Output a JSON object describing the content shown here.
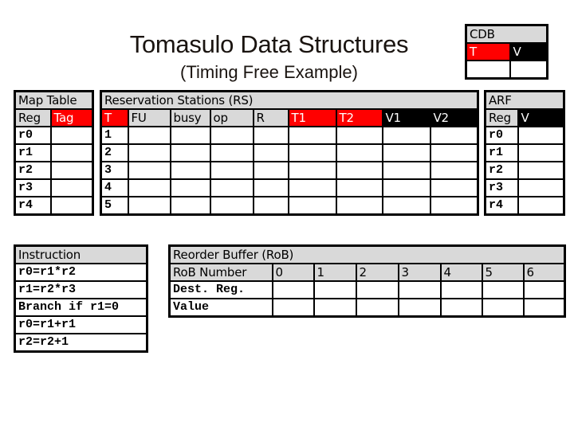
{
  "header": {
    "title": "Tomasulo Data Structures",
    "subtitle": "(Timing Free Example)"
  },
  "colors": {
    "tag_header": "#ff0000",
    "value_header": "#000000",
    "table_header": "#d9d9d9"
  },
  "cdb": {
    "title": "CDB",
    "columns": [
      "T",
      "V"
    ],
    "row": [
      "",
      ""
    ]
  },
  "map_table": {
    "title": "Map Table",
    "columns": [
      "Reg",
      "Tag"
    ],
    "rows": [
      {
        "reg": "r0",
        "tag": ""
      },
      {
        "reg": "r1",
        "tag": ""
      },
      {
        "reg": "r2",
        "tag": ""
      },
      {
        "reg": "r3",
        "tag": ""
      },
      {
        "reg": "r4",
        "tag": ""
      }
    ]
  },
  "reservation_stations": {
    "title": "Reservation Stations (RS)",
    "columns": [
      "T",
      "FU",
      "busy",
      "op",
      "R",
      "T1",
      "T2",
      "V1",
      "V2"
    ],
    "rows": [
      {
        "t": "1"
      },
      {
        "t": "2"
      },
      {
        "t": "3"
      },
      {
        "t": "4"
      },
      {
        "t": "5"
      }
    ]
  },
  "arf": {
    "title": "ARF",
    "columns": [
      "Reg",
      "V"
    ],
    "rows": [
      {
        "reg": "r0",
        "v": ""
      },
      {
        "reg": "r1",
        "v": ""
      },
      {
        "reg": "r2",
        "v": ""
      },
      {
        "reg": "r3",
        "v": ""
      },
      {
        "reg": "r4",
        "v": ""
      }
    ]
  },
  "instructions": {
    "title": "Instruction",
    "items": [
      "r0=r1*r2",
      "r1=r2*r3",
      "Branch if r1=0",
      "r0=r1+r1",
      "r2=r2+1"
    ]
  },
  "rob": {
    "title": "Reorder Buffer (RoB)",
    "number_label": "RoB Number",
    "numbers": [
      "0",
      "1",
      "2",
      "3",
      "4",
      "5",
      "6"
    ],
    "row_labels": [
      "Dest. Reg.",
      "Value"
    ]
  }
}
